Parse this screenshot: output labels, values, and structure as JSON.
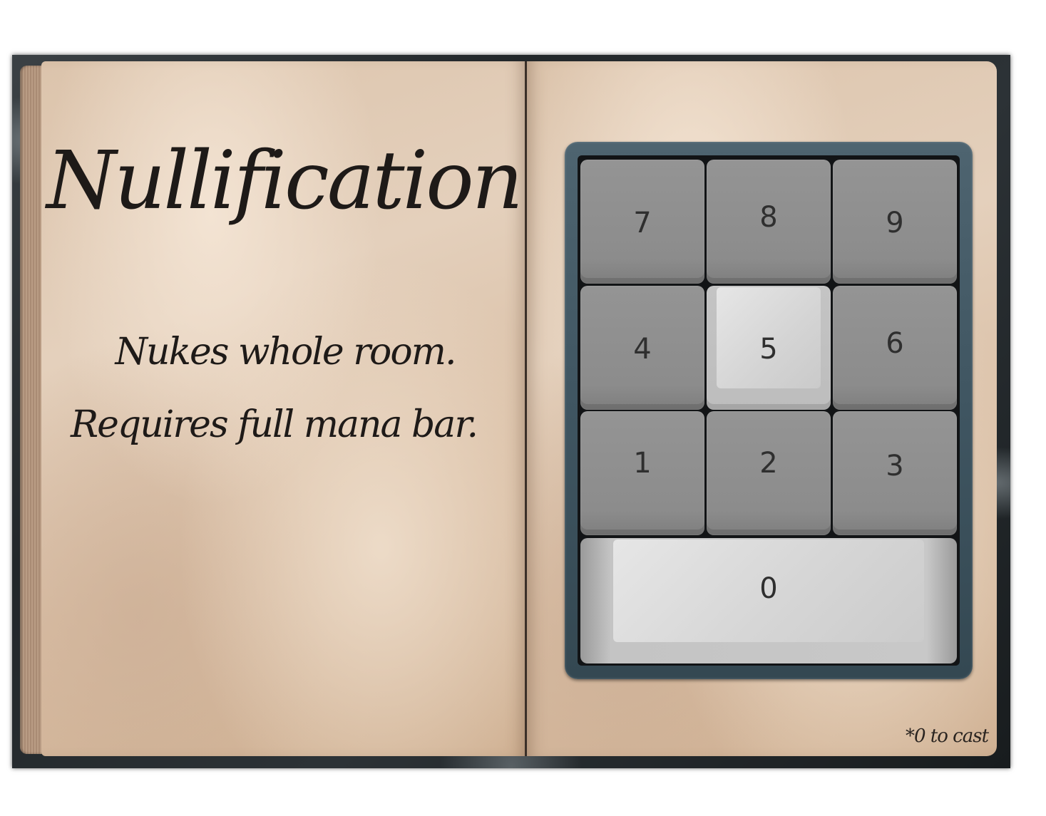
{
  "spellbook": {
    "title": "Nullification",
    "description": [
      "Nukes whole room.",
      "Requires full mana bar."
    ],
    "footnote": "*0 to cast"
  },
  "numpad": {
    "keys": {
      "k7": "7",
      "k8": "8",
      "k9": "9",
      "k4": "4",
      "k5": "5",
      "k6": "6",
      "k1": "1",
      "k2": "2",
      "k3": "3",
      "k0": "0"
    },
    "pressed_keys": [
      "5",
      "0"
    ],
    "colors": {
      "frame": "#4e6470",
      "key_idle": "#8f8f8f",
      "key_pressed": "#d4d4d4"
    }
  }
}
